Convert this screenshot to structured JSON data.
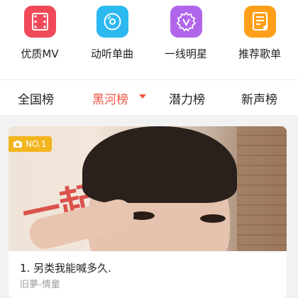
{
  "categories": [
    {
      "label": "优质MV",
      "icon": "film-icon",
      "color": "#f04a5a"
    },
    {
      "label": "动听单曲",
      "icon": "disc-icon",
      "color": "#2cb8f0"
    },
    {
      "label": "一线明星",
      "icon": "star-badge-icon",
      "color": "#b066ea"
    },
    {
      "label": "推荐歌单",
      "icon": "playlist-icon",
      "color": "#ff9f1a"
    }
  ],
  "tabs": [
    {
      "label": "全国榜"
    },
    {
      "label": "黑河榜"
    },
    {
      "label": "潜力榜"
    },
    {
      "label": "新声榜"
    }
  ],
  "active_tab": "黑河榜",
  "accent": "#f0533f",
  "card": {
    "badge": "NO.1",
    "badge_color": "#f2b51d",
    "photo_sign_text": "一起",
    "title": "1. 另类我能喊多久.",
    "artist": "旧夢-情童"
  }
}
